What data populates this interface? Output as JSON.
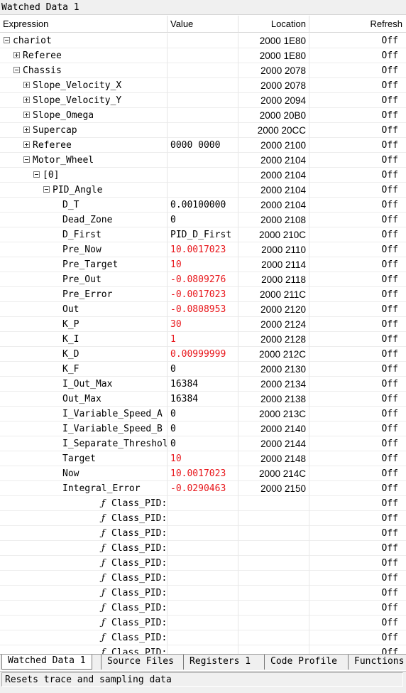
{
  "window": {
    "title": "Watched Data 1"
  },
  "columns": {
    "expression": "Expression",
    "value": "Value",
    "location": "Location",
    "refresh": "Refresh"
  },
  "rows": [
    {
      "indent": 0,
      "toggle": "minus",
      "fn": false,
      "expr": "chariot",
      "value": "",
      "value_red": false,
      "location": "2000 1E80",
      "refresh": "Off"
    },
    {
      "indent": 1,
      "toggle": "plus",
      "fn": false,
      "expr": "Referee",
      "value": "",
      "value_red": false,
      "location": "2000 1E80",
      "refresh": "Off"
    },
    {
      "indent": 1,
      "toggle": "minus",
      "fn": false,
      "expr": "Chassis",
      "value": "",
      "value_red": false,
      "location": "2000 2078",
      "refresh": "Off"
    },
    {
      "indent": 2,
      "toggle": "plus",
      "fn": false,
      "expr": "Slope_Velocity_X",
      "value": "",
      "value_red": false,
      "location": "2000 2078",
      "refresh": "Off"
    },
    {
      "indent": 2,
      "toggle": "plus",
      "fn": false,
      "expr": "Slope_Velocity_Y",
      "value": "",
      "value_red": false,
      "location": "2000 2094",
      "refresh": "Off"
    },
    {
      "indent": 2,
      "toggle": "plus",
      "fn": false,
      "expr": "Slope_Omega",
      "value": "",
      "value_red": false,
      "location": "2000 20B0",
      "refresh": "Off"
    },
    {
      "indent": 2,
      "toggle": "plus",
      "fn": false,
      "expr": "Supercap",
      "value": "",
      "value_red": false,
      "location": "2000 20CC",
      "refresh": "Off"
    },
    {
      "indent": 2,
      "toggle": "plus",
      "fn": false,
      "expr": "Referee",
      "value": "0000 0000",
      "value_red": false,
      "location": "2000 2100",
      "refresh": "Off"
    },
    {
      "indent": 2,
      "toggle": "minus",
      "fn": false,
      "expr": "Motor_Wheel",
      "value": "",
      "value_red": false,
      "location": "2000 2104",
      "refresh": "Off"
    },
    {
      "indent": 3,
      "toggle": "minus",
      "fn": false,
      "expr": "[0]",
      "value": "",
      "value_red": false,
      "location": "2000 2104",
      "refresh": "Off"
    },
    {
      "indent": 4,
      "toggle": "minus",
      "fn": false,
      "expr": "PID_Angle",
      "value": "",
      "value_red": false,
      "location": "2000 2104",
      "refresh": "Off"
    },
    {
      "indent": 5,
      "toggle": "none",
      "fn": false,
      "expr": "D_T",
      "value": "0.00100000",
      "value_red": false,
      "location": "2000 2104",
      "refresh": "Off"
    },
    {
      "indent": 5,
      "toggle": "none",
      "fn": false,
      "expr": "Dead_Zone",
      "value": "0",
      "value_red": false,
      "location": "2000 2108",
      "refresh": "Off"
    },
    {
      "indent": 5,
      "toggle": "none",
      "fn": false,
      "expr": "D_First",
      "value": "PID_D_First",
      "value_red": false,
      "location": "2000 210C",
      "refresh": "Off"
    },
    {
      "indent": 5,
      "toggle": "none",
      "fn": false,
      "expr": "Pre_Now",
      "value": "10.0017023",
      "value_red": true,
      "location": "2000 2110",
      "refresh": "Off"
    },
    {
      "indent": 5,
      "toggle": "none",
      "fn": false,
      "expr": "Pre_Target",
      "value": "10",
      "value_red": true,
      "location": "2000 2114",
      "refresh": "Off"
    },
    {
      "indent": 5,
      "toggle": "none",
      "fn": false,
      "expr": "Pre_Out",
      "value": "-0.0809276",
      "value_red": true,
      "location": "2000 2118",
      "refresh": "Off"
    },
    {
      "indent": 5,
      "toggle": "none",
      "fn": false,
      "expr": "Pre_Error",
      "value": "-0.0017023",
      "value_red": true,
      "location": "2000 211C",
      "refresh": "Off"
    },
    {
      "indent": 5,
      "toggle": "none",
      "fn": false,
      "expr": "Out",
      "value": "-0.0808953",
      "value_red": true,
      "location": "2000 2120",
      "refresh": "Off"
    },
    {
      "indent": 5,
      "toggle": "none",
      "fn": false,
      "expr": "K_P",
      "value": "30",
      "value_red": true,
      "location": "2000 2124",
      "refresh": "Off"
    },
    {
      "indent": 5,
      "toggle": "none",
      "fn": false,
      "expr": "K_I",
      "value": "1",
      "value_red": true,
      "location": "2000 2128",
      "refresh": "Off"
    },
    {
      "indent": 5,
      "toggle": "none",
      "fn": false,
      "expr": "K_D",
      "value": "0.00999999",
      "value_red": true,
      "location": "2000 212C",
      "refresh": "Off"
    },
    {
      "indent": 5,
      "toggle": "none",
      "fn": false,
      "expr": "K_F",
      "value": "0",
      "value_red": false,
      "location": "2000 2130",
      "refresh": "Off"
    },
    {
      "indent": 5,
      "toggle": "none",
      "fn": false,
      "expr": "I_Out_Max",
      "value": "16384",
      "value_red": false,
      "location": "2000 2134",
      "refresh": "Off"
    },
    {
      "indent": 5,
      "toggle": "none",
      "fn": false,
      "expr": "Out_Max",
      "value": "16384",
      "value_red": false,
      "location": "2000 2138",
      "refresh": "Off"
    },
    {
      "indent": 5,
      "toggle": "none",
      "fn": false,
      "expr": "I_Variable_Speed_A",
      "value": "0",
      "value_red": false,
      "location": "2000 213C",
      "refresh": "Off"
    },
    {
      "indent": 5,
      "toggle": "none",
      "fn": false,
      "expr": "I_Variable_Speed_B",
      "value": "0",
      "value_red": false,
      "location": "2000 2140",
      "refresh": "Off"
    },
    {
      "indent": 5,
      "toggle": "none",
      "fn": false,
      "expr": "I_Separate_Threshold",
      "value": "0",
      "value_red": false,
      "location": "2000 2144",
      "refresh": "Off"
    },
    {
      "indent": 5,
      "toggle": "none",
      "fn": false,
      "expr": "Target",
      "value": "10",
      "value_red": true,
      "location": "2000 2148",
      "refresh": "Off"
    },
    {
      "indent": 5,
      "toggle": "none",
      "fn": false,
      "expr": "Now",
      "value": "10.0017023",
      "value_red": true,
      "location": "2000 214C",
      "refresh": "Off"
    },
    {
      "indent": 5,
      "toggle": "none",
      "fn": false,
      "expr": "Integral_Error",
      "value": "-0.0290463",
      "value_red": true,
      "location": "2000 2150",
      "refresh": "Off"
    },
    {
      "indent": 5,
      "toggle": "none",
      "fn": true,
      "expr": "Class_PID::Init(class",
      "value": "",
      "value_red": false,
      "location": "",
      "refresh": "Off"
    },
    {
      "indent": 5,
      "toggle": "none",
      "fn": true,
      "expr": "Class_PID::Get_Integral_Error",
      "value": "",
      "value_red": false,
      "location": "",
      "refresh": "Off"
    },
    {
      "indent": 5,
      "toggle": "none",
      "fn": true,
      "expr": "Class_PID::Get_Out",
      "value": "",
      "value_red": false,
      "location": "",
      "refresh": "Off"
    },
    {
      "indent": 5,
      "toggle": "none",
      "fn": true,
      "expr": "Class_PID::Set_K_P",
      "value": "",
      "value_red": false,
      "location": "",
      "refresh": "Off"
    },
    {
      "indent": 5,
      "toggle": "none",
      "fn": true,
      "expr": "Class_PID::Set_K_I",
      "value": "",
      "value_red": false,
      "location": "",
      "refresh": "Off"
    },
    {
      "indent": 5,
      "toggle": "none",
      "fn": true,
      "expr": "Class_PID::Set_K_D",
      "value": "",
      "value_red": false,
      "location": "",
      "refresh": "Off"
    },
    {
      "indent": 5,
      "toggle": "none",
      "fn": true,
      "expr": "Class_PID::Set_K_F",
      "value": "",
      "value_red": false,
      "location": "",
      "refresh": "Off"
    },
    {
      "indent": 5,
      "toggle": "none",
      "fn": true,
      "expr": "Class_PID::Set_I_Out_Max",
      "value": "",
      "value_red": false,
      "location": "",
      "refresh": "Off"
    },
    {
      "indent": 5,
      "toggle": "none",
      "fn": true,
      "expr": "Class_PID::Set_Out_Max",
      "value": "",
      "value_red": false,
      "location": "",
      "refresh": "Off"
    },
    {
      "indent": 5,
      "toggle": "none",
      "fn": true,
      "expr": "Class_PID::Set_I_Variable_Speed_A",
      "value": "",
      "value_red": false,
      "location": "",
      "refresh": "Off"
    },
    {
      "indent": 5,
      "toggle": "none",
      "fn": true,
      "expr": "Class_PID::Set_I_Variable_Speed_B",
      "value": "",
      "value_red": false,
      "location": "",
      "refresh": "Off"
    }
  ],
  "tabs": [
    {
      "label": "Watched Data 1",
      "active": true
    },
    {
      "label": "Source Files",
      "active": false
    },
    {
      "label": "Registers 1",
      "active": false
    },
    {
      "label": "Code Profile",
      "active": false
    },
    {
      "label": "Functions",
      "active": false
    }
  ],
  "status": {
    "text": "Resets trace and sampling data"
  },
  "colors": {
    "changed_value": "#e8161b",
    "chrome": "#f0f0f0"
  },
  "icons": {
    "expand": "plus-box-icon",
    "collapse": "minus-box-icon",
    "function": "function-f-icon"
  }
}
